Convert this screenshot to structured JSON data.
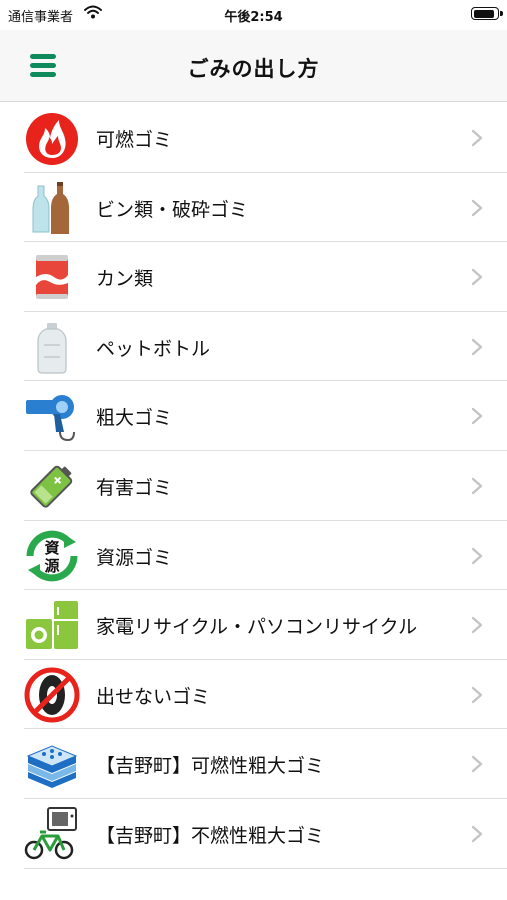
{
  "status": {
    "carrier": "通信事業者",
    "time": "午後2:54",
    "battery_level": 0.95
  },
  "header": {
    "title": "ごみの出し方",
    "menu_icon": "hamburger-menu-icon"
  },
  "accent_color": "#0f8a5c",
  "items": [
    {
      "label": "可燃ゴミ",
      "icon": "fire-icon"
    },
    {
      "label": "ビン類・破砕ゴミ",
      "icon": "bottles-icon"
    },
    {
      "label": "カン類",
      "icon": "can-icon"
    },
    {
      "label": "ペットボトル",
      "icon": "pet-bottle-icon"
    },
    {
      "label": "粗大ゴミ",
      "icon": "hair-dryer-icon"
    },
    {
      "label": "有害ゴミ",
      "icon": "battery-icon"
    },
    {
      "label": "資源ゴミ",
      "icon": "recycle-icon"
    },
    {
      "label": "家電リサイクル・パソコンリサイクル",
      "icon": "appliances-icon"
    },
    {
      "label": "出せないゴミ",
      "icon": "no-tire-icon"
    },
    {
      "label": "【吉野町】可燃性粗大ゴミ",
      "icon": "futon-icon"
    },
    {
      "label": "【吉野町】不燃性粗大ゴミ",
      "icon": "bicycle-tv-icon"
    }
  ]
}
